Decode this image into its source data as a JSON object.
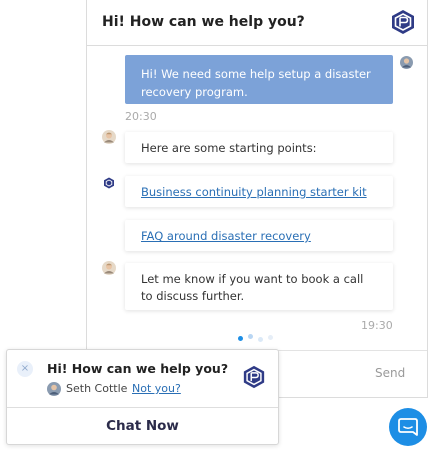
{
  "chat": {
    "title": "Hi! How can we help you?",
    "user_message": "Hi! We need some help setup a disaster recovery program.",
    "user_timestamp": "20:30",
    "bot_messages": [
      {
        "text": "Here are some starting points:"
      },
      {
        "text": "Business continuity planning starter kit",
        "is_link": true
      },
      {
        "text": "FAQ around disaster recovery",
        "is_link": true
      },
      {
        "text": "Let me know if you want to book a call to discuss further."
      }
    ],
    "bot_timestamp": "19:30",
    "send_label": "Send"
  },
  "teaser": {
    "title": "Hi! How can we help you?",
    "agent_name": "Seth Cottle",
    "not_you_label": "Not you?",
    "close_icon": "×",
    "cta_label": "Chat Now"
  },
  "icons": {
    "brand_logo": "hexagon-logo-icon",
    "launcher": "chat-bubble-icon",
    "close": "close-icon"
  },
  "colors": {
    "accent": "#1d8ee5",
    "user_bubble": "#7ca2d8",
    "link": "#2a6fb5",
    "logo": "#2f3b86"
  }
}
